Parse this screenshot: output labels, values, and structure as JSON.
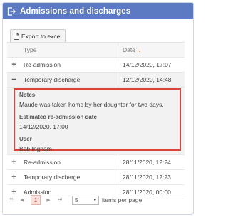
{
  "header": {
    "title": "Admissions and discharges",
    "icon": "sign-out-icon"
  },
  "toolbar": {
    "export_label": "Export to excel",
    "export_icon": "file-icon"
  },
  "table": {
    "columns": {
      "type": "Type",
      "date": "Date",
      "date_sort_icon": "↓"
    },
    "rows_before": [
      {
        "expander": "+",
        "type": "Re-admission",
        "date": "14/12/2020, 17:07"
      }
    ],
    "expanded_row": {
      "expander": "−",
      "type": "Temporary discharge",
      "date": "12/12/2020, 14:48"
    },
    "detail": {
      "notes_label": "Notes",
      "notes_value": "Maude was taken home by her daughter for two days.",
      "readmission_label": "Estimated re-admission date",
      "readmission_value": "14/12/2020, 17:00",
      "user_label": "User",
      "user_value": "Bob Ingham"
    },
    "rows_after": [
      {
        "expander": "+",
        "type": "Re-admission",
        "date": "28/11/2020, 12:24"
      },
      {
        "expander": "+",
        "type": "Temporary discharge",
        "date": "28/11/2020, 12:23"
      },
      {
        "expander": "+",
        "type": "Admission",
        "date": "28/11/2020, 00:00"
      }
    ]
  },
  "pager": {
    "first": "⏮",
    "prev": "◀",
    "page": "1",
    "next": "▶",
    "last": "⏭",
    "page_size": "5",
    "page_size_label": "items per page"
  },
  "colors": {
    "header_bg": "#5c79c4",
    "highlight_border": "#d9453b",
    "sort_arrow": "#e8742a"
  }
}
